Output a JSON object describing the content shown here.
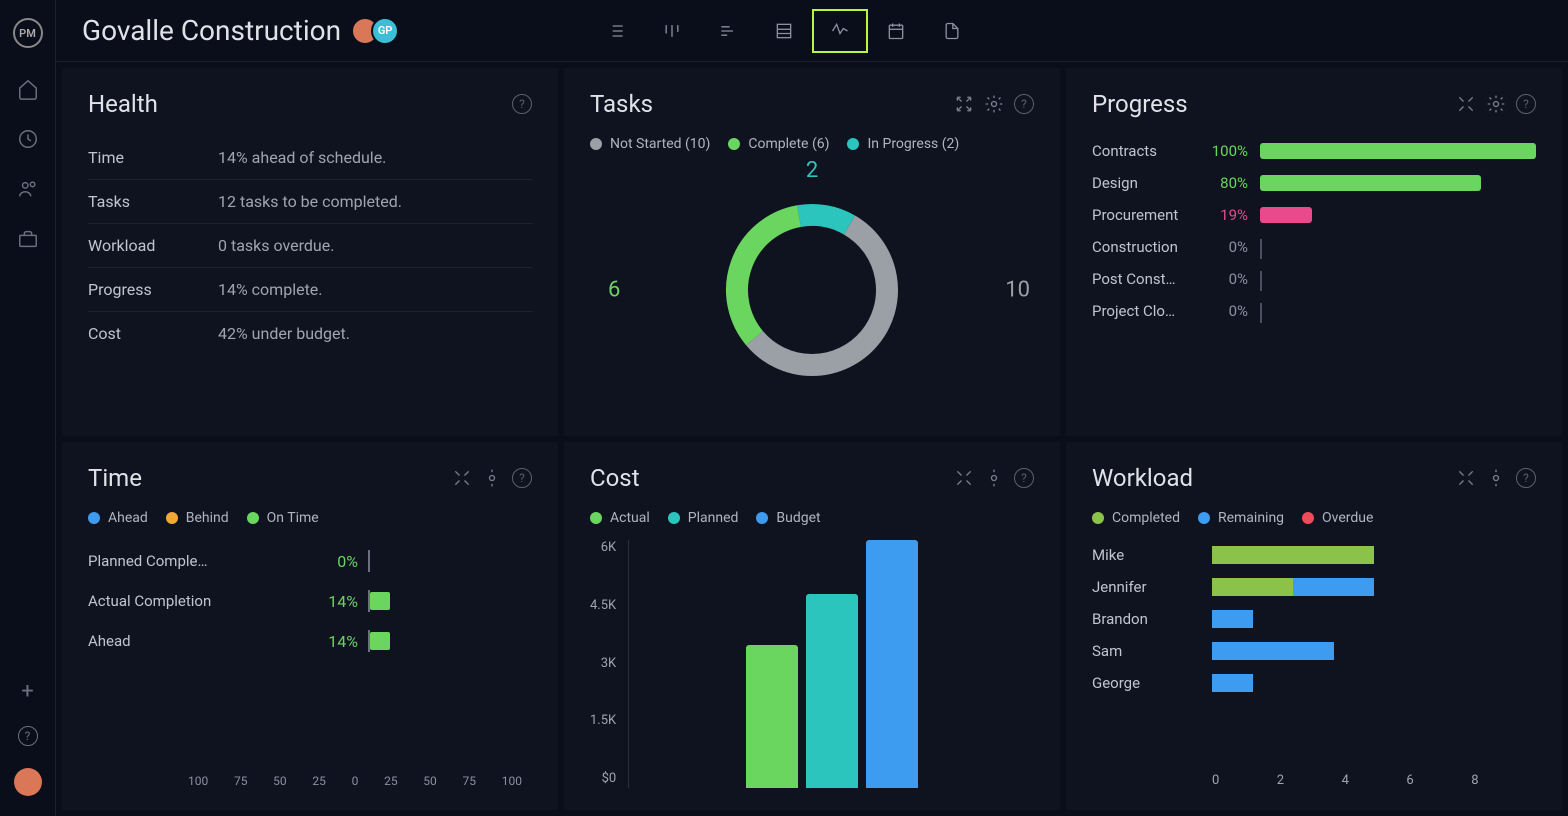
{
  "logo": "PM",
  "project_title": "Govalle Construction",
  "avatar2_initials": "GP",
  "colors": {
    "not_started": "#9aa0a6",
    "complete": "#6bd65f",
    "in_progress": "#2cc5bd",
    "ahead": "#3d9bf0",
    "behind": "#f0a933",
    "on_time": "#6bd65f",
    "actual": "#6bd65f",
    "planned": "#2cc5bd",
    "budget": "#3d9bf0",
    "wl_completed": "#8bc34a",
    "wl_remaining": "#3d9bf0",
    "wl_overdue": "#f04a5a",
    "prog_pink": "#e84a8c"
  },
  "panels": {
    "health": {
      "title": "Health",
      "rows": [
        {
          "label": "Time",
          "value": "14% ahead of schedule."
        },
        {
          "label": "Tasks",
          "value": "12 tasks to be completed."
        },
        {
          "label": "Workload",
          "value": "0 tasks overdue."
        },
        {
          "label": "Progress",
          "value": "14% complete."
        },
        {
          "label": "Cost",
          "value": "42% under budget."
        }
      ]
    },
    "tasks": {
      "title": "Tasks",
      "legend": [
        {
          "label": "Not Started",
          "count": 10,
          "color": "not_started"
        },
        {
          "label": "Complete",
          "count": 6,
          "color": "complete"
        },
        {
          "label": "In Progress",
          "count": 2,
          "color": "in_progress"
        }
      ],
      "donut_labels": {
        "top": "2",
        "left": "6",
        "right": "10"
      }
    },
    "progress": {
      "title": "Progress",
      "rows": [
        {
          "name": "Contracts",
          "pct": 100,
          "color": "complete"
        },
        {
          "name": "Design",
          "pct": 80,
          "color": "complete"
        },
        {
          "name": "Procurement",
          "pct": 19,
          "color": "prog_pink"
        },
        {
          "name": "Construction",
          "pct": 0,
          "color": "not_started"
        },
        {
          "name": "Post Const…",
          "pct": 0,
          "color": "not_started"
        },
        {
          "name": "Project Clo…",
          "pct": 0,
          "color": "not_started"
        }
      ]
    },
    "time": {
      "title": "Time",
      "legend": [
        {
          "label": "Ahead",
          "color": "ahead"
        },
        {
          "label": "Behind",
          "color": "behind"
        },
        {
          "label": "On Time",
          "color": "on_time"
        }
      ],
      "rows": [
        {
          "label": "Planned Comple…",
          "pct": 0
        },
        {
          "label": "Actual Completion",
          "pct": 14
        },
        {
          "label": "Ahead",
          "pct": 14
        }
      ],
      "axis": [
        "100",
        "75",
        "50",
        "25",
        "0",
        "25",
        "50",
        "75",
        "100"
      ]
    },
    "cost": {
      "title": "Cost",
      "legend": [
        {
          "label": "Actual",
          "color": "actual"
        },
        {
          "label": "Planned",
          "color": "planned"
        },
        {
          "label": "Budget",
          "color": "budget"
        }
      ],
      "yaxis": [
        "6K",
        "4.5K",
        "3K",
        "1.5K",
        "$0"
      ],
      "bars": [
        {
          "name": "Actual",
          "value": 3450,
          "color": "actual"
        },
        {
          "name": "Planned",
          "value": 4700,
          "color": "planned"
        },
        {
          "name": "Budget",
          "value": 6000,
          "color": "budget"
        }
      ],
      "ymax": 6000
    },
    "workload": {
      "title": "Workload",
      "legend": [
        {
          "label": "Completed",
          "color": "wl_completed"
        },
        {
          "label": "Remaining",
          "color": "wl_remaining"
        },
        {
          "label": "Overdue",
          "color": "wl_overdue"
        }
      ],
      "rows": [
        {
          "name": "Mike",
          "completed": 4,
          "remaining": 0,
          "overdue": 0
        },
        {
          "name": "Jennifer",
          "completed": 2,
          "remaining": 2,
          "overdue": 0
        },
        {
          "name": "Brandon",
          "completed": 0,
          "remaining": 1,
          "overdue": 0
        },
        {
          "name": "Sam",
          "completed": 0,
          "remaining": 3,
          "overdue": 0
        },
        {
          "name": "George",
          "completed": 0,
          "remaining": 1,
          "overdue": 0
        }
      ],
      "axis": [
        "0",
        "2",
        "4",
        "6",
        "8"
      ],
      "xmax": 8
    }
  },
  "chart_data": [
    {
      "type": "pie",
      "title": "Tasks",
      "categories": [
        "Not Started",
        "Complete",
        "In Progress"
      ],
      "values": [
        10,
        6,
        2
      ]
    },
    {
      "type": "bar",
      "title": "Progress",
      "categories": [
        "Contracts",
        "Design",
        "Procurement",
        "Construction",
        "Post Construction",
        "Project Closeout"
      ],
      "values": [
        100,
        80,
        19,
        0,
        0,
        0
      ],
      "ylabel": "%",
      "ylim": [
        0,
        100
      ]
    },
    {
      "type": "bar",
      "title": "Time",
      "categories": [
        "Planned Completion",
        "Actual Completion",
        "Ahead"
      ],
      "values": [
        0,
        14,
        14
      ],
      "ylabel": "%",
      "ylim": [
        -100,
        100
      ]
    },
    {
      "type": "bar",
      "title": "Cost",
      "categories": [
        "Actual",
        "Planned",
        "Budget"
      ],
      "values": [
        3450,
        4700,
        6000
      ],
      "ylabel": "$",
      "ylim": [
        0,
        6000
      ]
    },
    {
      "type": "bar",
      "title": "Workload",
      "categories": [
        "Mike",
        "Jennifer",
        "Brandon",
        "Sam",
        "George"
      ],
      "series": [
        {
          "name": "Completed",
          "values": [
            4,
            2,
            0,
            0,
            0
          ]
        },
        {
          "name": "Remaining",
          "values": [
            0,
            2,
            1,
            3,
            1
          ]
        },
        {
          "name": "Overdue",
          "values": [
            0,
            0,
            0,
            0,
            0
          ]
        }
      ],
      "xlim": [
        0,
        8
      ]
    }
  ]
}
